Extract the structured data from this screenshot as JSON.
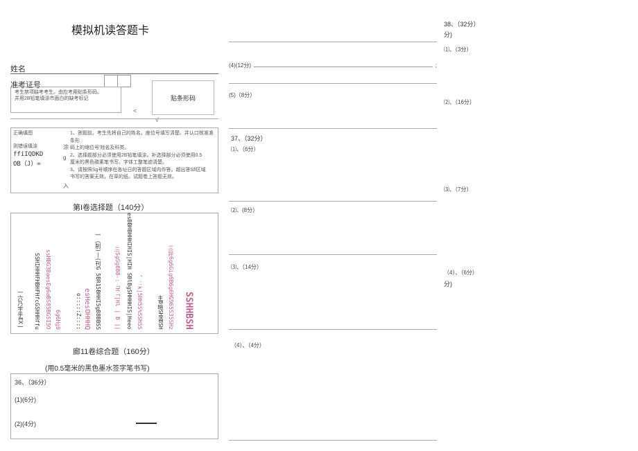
{
  "page": {
    "title": "模拟机读答题卡"
  },
  "fields": {
    "name_label": "姓名",
    "exam_id_label": "准考证号",
    "barcode_label": "贴条形码",
    "arrow_char": "<",
    "check_char": "√"
  },
  "exam_note": {
    "line1": "考生禁项缺考考生。由应考用贴条形码。",
    "line2": "并用2B铅笔填涂市面白的缺考标记"
  },
  "fill_example": {
    "left_line1": "正确填图",
    "left_line2": "则错误填涂",
    "left_line3": "涂",
    "left_code1": "ffiIQDKD",
    "left_code2": "OB（J）=",
    "left_code3": "g",
    "left_code4": "入",
    "right_line1": "1、答题前。考生先将自己的姓名。座位号填写清楚。并认口核准准条形",
    "right_line2": "码上的缩位号'姓名及科类。",
    "right_line3": "2、选择题部分必须使用2B铅笔填涂。补选择部分必须使用0.5",
    "right_line4": "厘米的黑色碳素笔书写。字体工整笔迹清楚。",
    "right_line5": "3、请按照Sg号顺序在各址日的答题区域内作答。超出答Sfl区域",
    "right_line6": "书写的答案无效。在草的纸。试题卷上答题无效。"
  },
  "section1": {
    "title": "第I卷选择题（140分）",
    "garble1": "一六乃字乎EX一",
    "garble2": "SSHIHHHFHBHFHfcGSHHHffu",
    "garble3": "ssHBG3BaesEg6aBS85BGSI5O",
    "garble4": "6g6Hg9",
    "garble5": "o:::::Z::::",
    "garble6": "esHesOHHHQ",
    "garble7": "一（削)丨(刊G 5BR15BHHI5gB8BBSS",
    "garble8": "三SgSg8B8-:「H「|Hl | B ||",
    "garble9": "esBBHBHHHIHIS|HIH SBlBgSHHHHIS|Heeo",
    "garble10": "、：k|5HH5S%SSH5S",
    "garble11": "主B暗SHHBSH",
    "garble12": "三异6g6Gig6B6g6HG965S35SHz",
    "garble13": "SSHHBSH"
  },
  "section2": {
    "title": "廊11卷综合题（160分）",
    "subtitle": "(用0.5毫米的黑色墨水签字笔书写)"
  },
  "q36": {
    "header": "36、（36分）",
    "p1": "(1)(6分)",
    "p2": "(2)(4分)"
  },
  "mid_col": {
    "q4_12": "(4)(12分)",
    "q5_8": "(5)（8分）",
    "q37_header": "37、（32分）",
    "q37_1": "⑴、（6分）",
    "q37_2": "⑵、(8分）",
    "q37_3": "⑶、（14分）",
    "q37_4": "（4）、（4分）"
  },
  "right_col": {
    "q38_header": "38、（32分）",
    "q38_sub": "分)",
    "r1": "⑴、（3分）",
    "r2": "⑵、（16分）",
    "r3": "⑶、（7分）",
    "r4": "（4）、（6分）",
    "r4_sub": "分)"
  }
}
